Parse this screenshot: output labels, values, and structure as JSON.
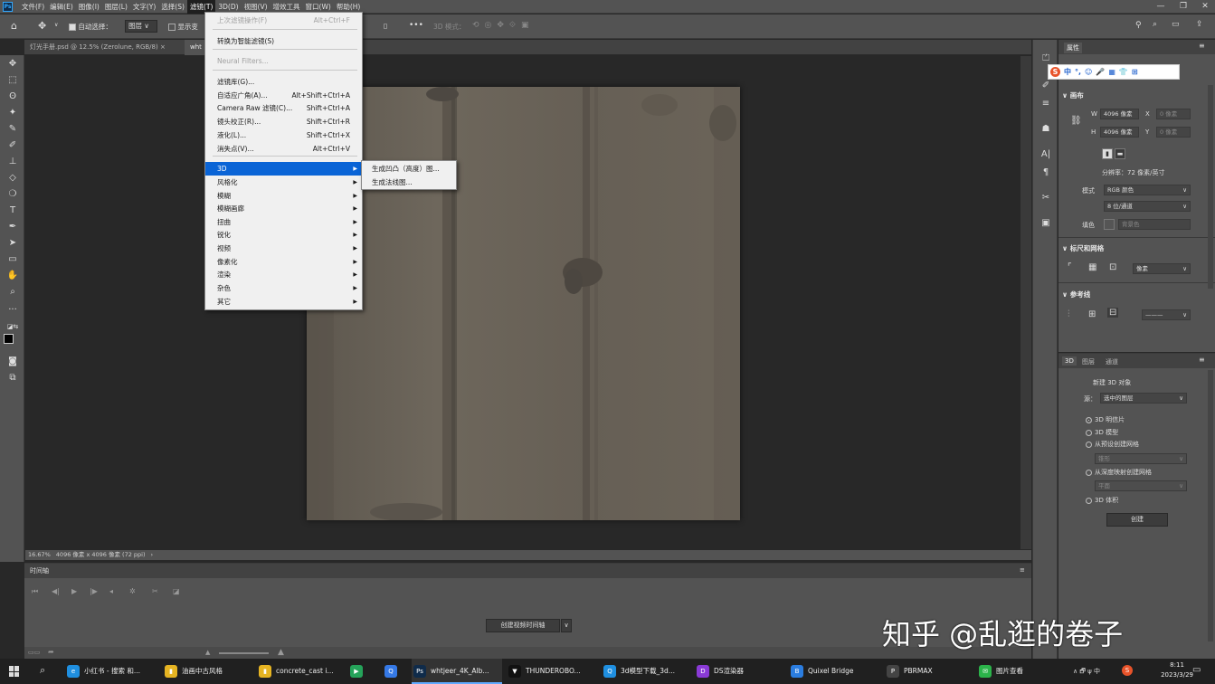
{
  "app": {
    "logo": "Ps"
  },
  "menubar": {
    "items": [
      "文件(F)",
      "编辑(E)",
      "图像(I)",
      "图层(L)",
      "文字(Y)",
      "选择(S)",
      "滤镜(T)",
      "3D(D)",
      "视图(V)",
      "增效工具",
      "窗口(W)",
      "帮助(H)"
    ],
    "active_index": 6,
    "window_controls": [
      "—",
      "❐",
      "✕"
    ]
  },
  "options": {
    "auto_select_label": "自动选择：",
    "layer_select": "图层",
    "show_transform_label": "显示变",
    "mode_3d_label": "3D 模式：",
    "more": "•••"
  },
  "tabs": [
    {
      "label": "灯光手册.psd @ 12.5% (Zerolune, RGB/8)",
      "close": "×"
    },
    {
      "label": "wht",
      "close": ""
    }
  ],
  "canvas": {
    "texture_color": "#6b6459"
  },
  "status": {
    "zoom": "16.67%",
    "doc_size": "4096 像素 x 4096 像素 (72 ppi)",
    "arrow": "›"
  },
  "timeline": {
    "title": "时间轴",
    "create_button": "创建视频时间轴",
    "dropdown": "∨"
  },
  "filter_menu": {
    "items": [
      {
        "label": "上次滤镜操作(F)",
        "shortcut": "Alt+Ctrl+F",
        "disabled": true
      },
      {
        "label": "转换为智能滤镜(S)",
        "shortcut": ""
      },
      {
        "label": "Neural Filters...",
        "shortcut": "",
        "disabled": true
      },
      {
        "label": "滤镜库(G)...",
        "shortcut": ""
      },
      {
        "label": "自适应广角(A)...",
        "shortcut": "Alt+Shift+Ctrl+A"
      },
      {
        "label": "Camera Raw 滤镜(C)...",
        "shortcut": "Shift+Ctrl+A"
      },
      {
        "label": "镜头校正(R)...",
        "shortcut": "Shift+Ctrl+R"
      },
      {
        "label": "液化(L)...",
        "shortcut": "Shift+Ctrl+X"
      },
      {
        "label": "消失点(V)...",
        "shortcut": "Alt+Ctrl+V"
      },
      {
        "label": "3D",
        "submenu": true,
        "highlighted": true
      },
      {
        "label": "风格化",
        "submenu": true
      },
      {
        "label": "模糊",
        "submenu": true
      },
      {
        "label": "模糊画廊",
        "submenu": true
      },
      {
        "label": "扭曲",
        "submenu": true
      },
      {
        "label": "锐化",
        "submenu": true
      },
      {
        "label": "视频",
        "submenu": true
      },
      {
        "label": "像素化",
        "submenu": true
      },
      {
        "label": "渲染",
        "submenu": true
      },
      {
        "label": "杂色",
        "submenu": true
      },
      {
        "label": "其它",
        "submenu": true
      }
    ],
    "submenu_3d": [
      "生成凹凸（高度）图...",
      "生成法线图..."
    ]
  },
  "properties": {
    "tab": "属性",
    "canvas_section": "画布",
    "w_label": "W",
    "w_value": "4096 像素",
    "h_label": "H",
    "h_value": "4096 像素",
    "x_label": "X",
    "x_value": "0 像素",
    "y_label": "Y",
    "y_value": "0 像素",
    "resolution": "分辨率：72 像素/英寸",
    "mode_label": "模式",
    "mode_value": "RGB 颜色",
    "depth_value": "8 位/通道",
    "fill_label": "填色",
    "fill_value": "背景色",
    "rulers_section": "标尺和网格",
    "units_value": "像素",
    "guides_section": "参考线"
  },
  "panel3d": {
    "tabs": [
      "3D",
      "图层",
      "通道"
    ],
    "title": "新建 3D 对象",
    "source_label": "源：",
    "source_value": "选中的图层",
    "options": [
      "3D 明信片",
      "3D 模型",
      "从预设创建网格",
      "从深度映射创建网格",
      "3D 体积"
    ],
    "selected_index": 0,
    "preset_value": "锥形",
    "depth_value": "平面",
    "create_button": "创建"
  },
  "ime": {
    "items": [
      "S",
      "中",
      "°,",
      "☺",
      "🎤",
      "▦",
      "👕",
      "⊞"
    ]
  },
  "watermark": "知乎 @乱逛的卷子",
  "taskbar": {
    "items": [
      {
        "label": "小红书 - 搜索 和...",
        "color": "#1f8fe0",
        "icon": "e"
      },
      {
        "label": "油画中古风格",
        "color": "#e6b422",
        "icon": "▮"
      },
      {
        "label": "concrete_cast i...",
        "color": "#e6b422",
        "icon": "▮"
      },
      {
        "label": "",
        "color": "#25a35a",
        "icon": "▶"
      },
      {
        "label": "",
        "color": "#3579e6",
        "icon": "Q"
      },
      {
        "label": "whtjeer_4K_Alb...",
        "color": "#0f2b4a",
        "icon": "Ps"
      },
      {
        "label": "THUNDEROBO...",
        "color": "#111111",
        "icon": "▼"
      },
      {
        "label": "3d模型下载_3d...",
        "color": "#1f8fe0",
        "icon": "Q"
      },
      {
        "label": "DS渲染器",
        "color": "#8a3ad6",
        "icon": "D"
      },
      {
        "label": "Quixel Bridge",
        "color": "#2b7de0",
        "icon": "B"
      },
      {
        "label": "PBRMAX",
        "color": "#444444",
        "icon": "P"
      },
      {
        "label": "图片查看",
        "color": "#2bb34a",
        "icon": "✉"
      }
    ],
    "active_index": 5,
    "tray": "∧ 🗗 ψ 中",
    "time": "8:11",
    "date": "2023/3/29"
  }
}
